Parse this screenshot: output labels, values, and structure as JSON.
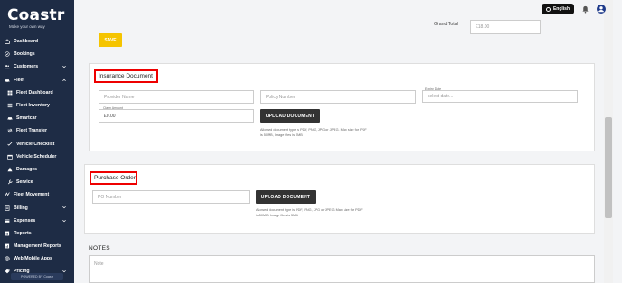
{
  "brand": {
    "name": "Coastr",
    "tagline": "Make your own way"
  },
  "sidebar": {
    "items": [
      {
        "label": "Dashboard",
        "icon": "home-icon",
        "sub": false,
        "chevron": ""
      },
      {
        "label": "Bookings",
        "icon": "check-circle-icon",
        "sub": false,
        "chevron": ""
      },
      {
        "label": "Customers",
        "icon": "users-icon",
        "sub": false,
        "chevron": "down"
      },
      {
        "label": "Fleet",
        "icon": "car-icon",
        "sub": false,
        "chevron": "up"
      },
      {
        "label": "Fleet Dashboard",
        "icon": "grid-icon",
        "sub": true,
        "chevron": ""
      },
      {
        "label": "Fleet Inventory",
        "icon": "list-icon",
        "sub": true,
        "chevron": ""
      },
      {
        "label": "Smartcar",
        "icon": "car-icon",
        "sub": true,
        "chevron": ""
      },
      {
        "label": "Fleet Transfer",
        "icon": "transfer-icon",
        "sub": true,
        "chevron": ""
      },
      {
        "label": "Vehicle Checklist",
        "icon": "checklist-icon",
        "sub": true,
        "chevron": ""
      },
      {
        "label": "Vehicle Scheduler",
        "icon": "calendar-icon",
        "sub": true,
        "chevron": ""
      },
      {
        "label": "Damages",
        "icon": "warning-icon",
        "sub": true,
        "chevron": ""
      },
      {
        "label": "Service",
        "icon": "wrench-icon",
        "sub": true,
        "chevron": ""
      },
      {
        "label": "Fleet Movement",
        "icon": "route-icon",
        "sub": false,
        "chevron": ""
      },
      {
        "label": "Billing",
        "icon": "billing-icon",
        "sub": false,
        "chevron": "down"
      },
      {
        "label": "Expenses",
        "icon": "expenses-icon",
        "sub": false,
        "chevron": "down"
      },
      {
        "label": "Reports",
        "icon": "report-icon",
        "sub": false,
        "chevron": ""
      },
      {
        "label": "Management Reports",
        "icon": "report-icon",
        "sub": false,
        "chevron": ""
      },
      {
        "label": "Web/Mobile Apps",
        "icon": "globe-icon",
        "sub": false,
        "chevron": ""
      },
      {
        "label": "Pricing",
        "icon": "pricing-icon",
        "sub": false,
        "chevron": "down"
      }
    ],
    "powered_by": "POWERED BY Coastr"
  },
  "topbar": {
    "language": "English",
    "bell_icon": "bell-icon",
    "user_icon": "user-avatar-icon"
  },
  "totals": {
    "grand_total_label": "Grand Total",
    "grand_total_value": "£18.00"
  },
  "save_label": "SAVE",
  "insurance": {
    "title": "Insurance Document",
    "provider_placeholder": "Provider Name",
    "policy_placeholder": "Policy Number",
    "expiry_label": "Expiry Date",
    "expiry_placeholder": "select date...",
    "claim_label": "Claim Amount",
    "claim_value": "£0.00",
    "upload_label": "UPLOAD DOCUMENT",
    "hint_line1": "Allowed document type is PDF, PNG, JPG or JPEG. Max size for PDF",
    "hint_line2": "is 50MB, Image files is 5MB"
  },
  "purchase_order": {
    "title": "Purchase Order",
    "po_placeholder": "PO Number",
    "upload_label": "UPLOAD DOCUMENT",
    "hint_line1": "Allowed document type is PDF, PNG, JPG or JPEG. Max size for PDF",
    "hint_line2": "is 50MB, Image files is 5MB"
  },
  "notes": {
    "label": "NOTES",
    "placeholder": "Note"
  },
  "colors": {
    "sidebar_bg": "#1e2c45",
    "save_button": "#f5c400",
    "upload_button": "#333333",
    "highlight_border": "#ee0000"
  }
}
